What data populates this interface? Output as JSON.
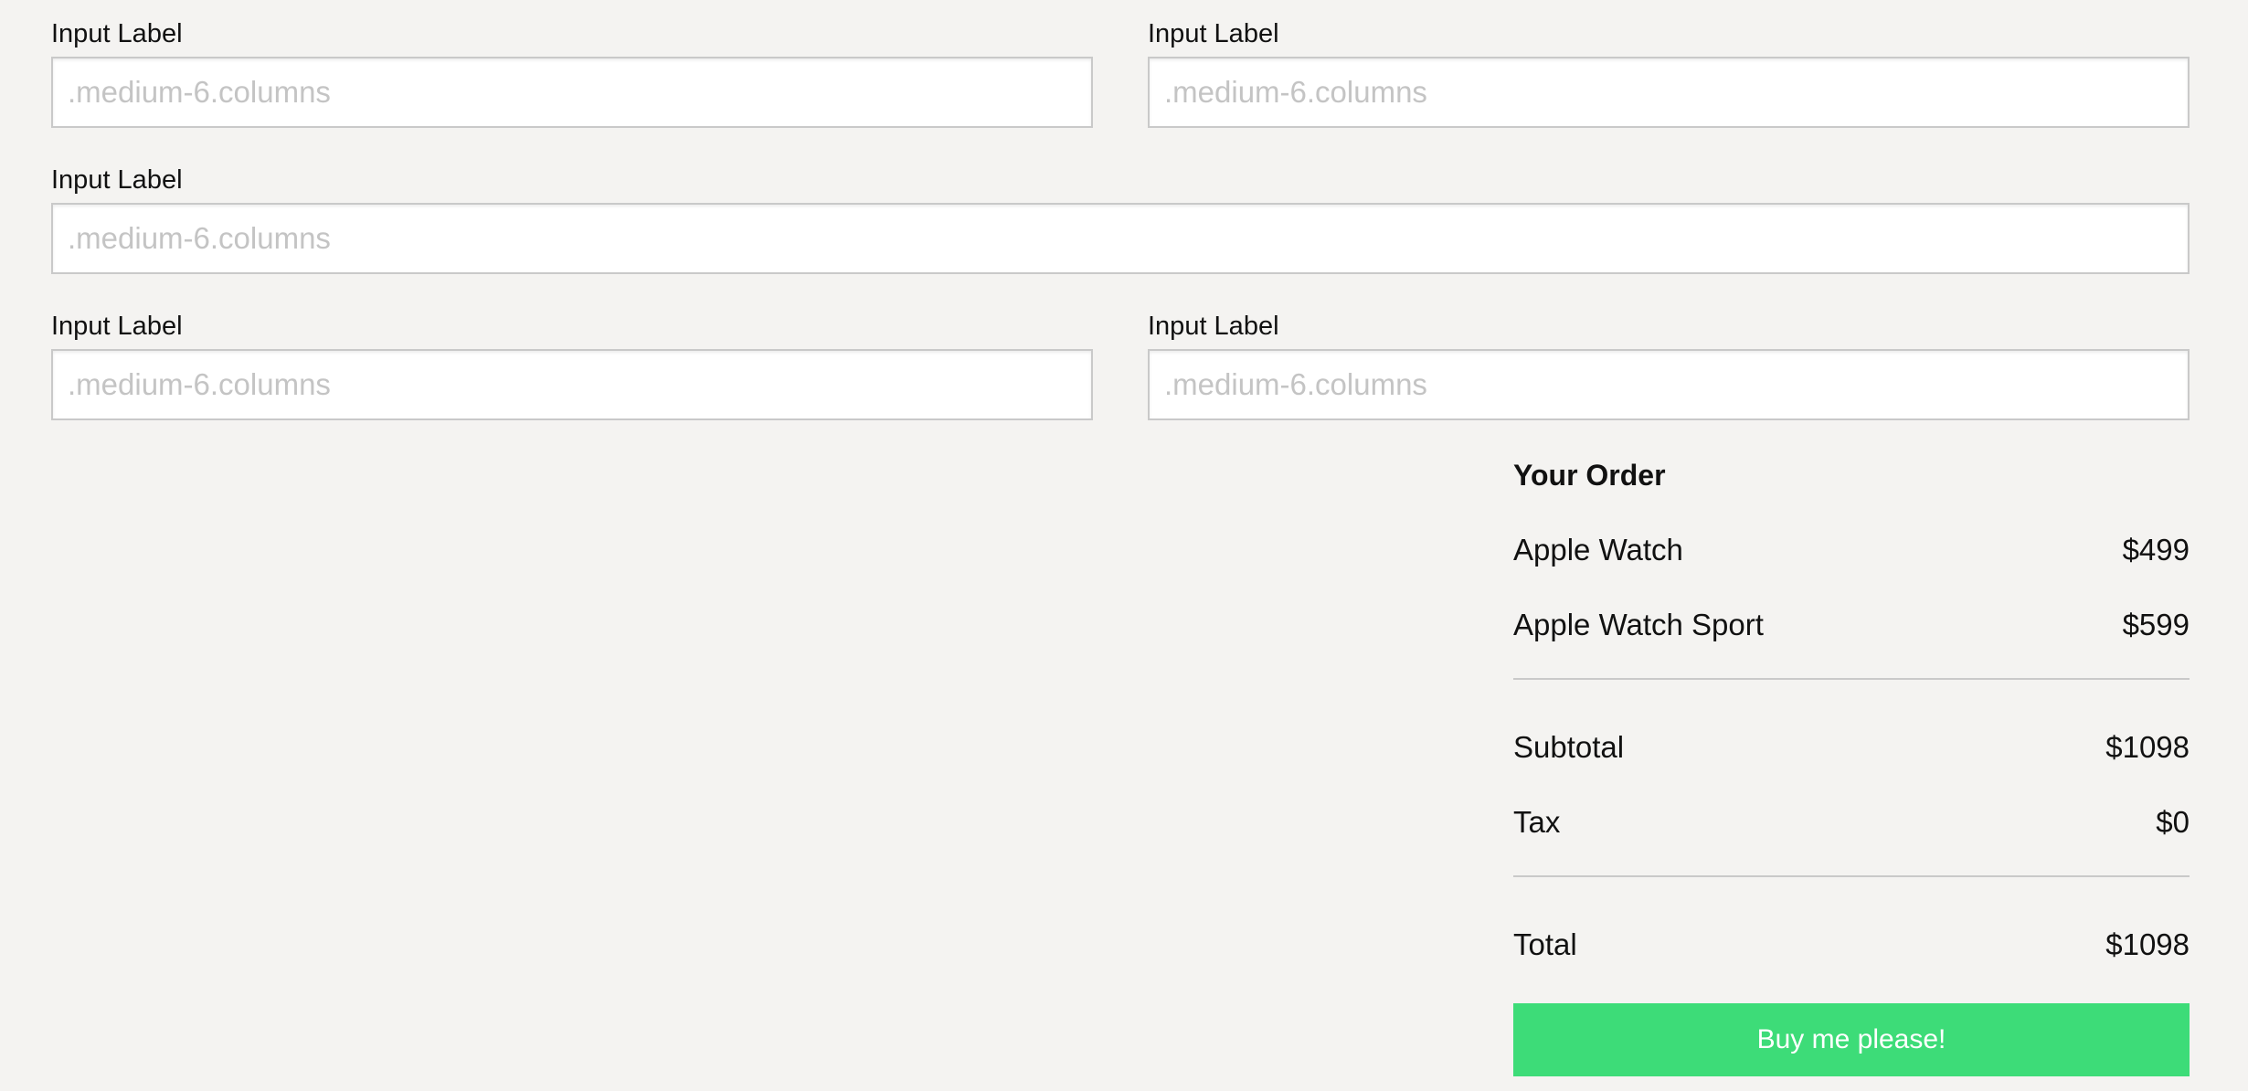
{
  "form": {
    "rows": [
      [
        {
          "label": "Input Label",
          "placeholder": ".medium-6.columns",
          "value": ""
        },
        {
          "label": "Input Label",
          "placeholder": ".medium-6.columns",
          "value": ""
        }
      ],
      [
        {
          "label": "Input Label",
          "placeholder": ".medium-6.columns",
          "value": ""
        }
      ],
      [
        {
          "label": "Input Label",
          "placeholder": ".medium-6.columns",
          "value": ""
        },
        {
          "label": "Input Label",
          "placeholder": ".medium-6.columns",
          "value": ""
        }
      ]
    ]
  },
  "order": {
    "title": "Your Order",
    "items": [
      {
        "name": "Apple Watch",
        "price": "$499"
      },
      {
        "name": "Apple Watch Sport",
        "price": "$599"
      }
    ],
    "subtotal": {
      "label": "Subtotal",
      "value": "$1098"
    },
    "tax": {
      "label": "Tax",
      "value": "$0"
    },
    "total": {
      "label": "Total",
      "value": "$1098"
    },
    "button_label": "Buy me please!"
  },
  "colors": {
    "background": "#f4f3f1",
    "button": "#3ddc78",
    "input_border": "#c9c9c9",
    "placeholder": "#c4c4c4"
  }
}
